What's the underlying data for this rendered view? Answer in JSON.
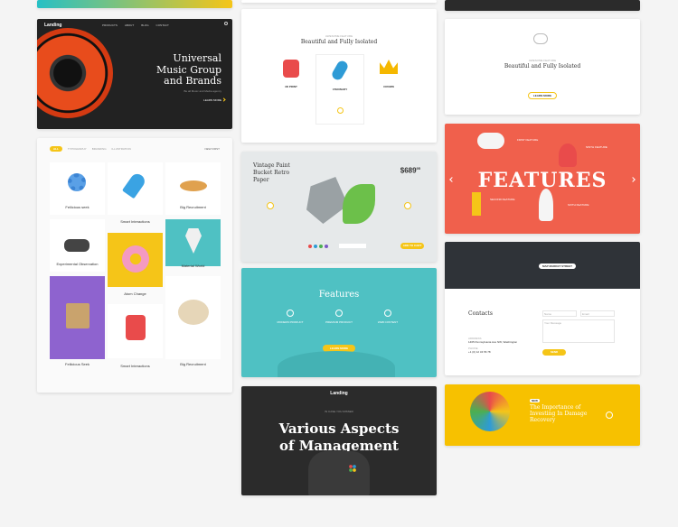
{
  "music": {
    "logo": "Landing",
    "nav": [
      "PRODUCTS",
      "ABOUT",
      "BLOG",
      "CONTACT"
    ],
    "title_lines": [
      "Universal",
      "Music Group",
      "and Brands"
    ],
    "subtitle": "Be all Music and Media agency",
    "cta": "LEARN MORE",
    "accent": "#f5c518"
  },
  "catalog": {
    "filters": [
      "ALL",
      "TYPOGRAPHY",
      "BRANDING",
      "ILLUSTRATION"
    ],
    "sort": "NEW FIRST",
    "items": [
      {
        "title": "Feliicious seek",
        "sub": "Illustration"
      },
      {
        "title": "Smart Interactions",
        "sub": "Illustration"
      },
      {
        "title": "Big Recruitment",
        "sub": "Illustration"
      },
      {
        "title": "Experimental Observation",
        "sub": "Illustration"
      },
      {
        "title": "Material World",
        "sub": "Illustration"
      },
      {
        "title": "Atom Change",
        "sub": "Illustration"
      },
      {
        "title": "Feliicious Seek",
        "sub": "Illustration"
      },
      {
        "title": "Smart Interactions",
        "sub": "Illustration"
      },
      {
        "title": "Big Recruitment",
        "sub": "Illustration"
      }
    ]
  },
  "features_white": {
    "label": "AWESOME FEATURE",
    "title": "Beautiful and Fully Isolated",
    "items": [
      {
        "name": "3D PRINT",
        "color": "#e94b4b"
      },
      {
        "name": "VISIONARY",
        "color": "#2e9bd6"
      },
      {
        "name": "CROWN",
        "color": "#f5b800"
      }
    ]
  },
  "product": {
    "title_lines": [
      "Vintage Paint",
      "Bucket Retro",
      "Paper"
    ],
    "price": "$689",
    "price_cents": "95",
    "cta": "ADD TO CART",
    "swatches": [
      "#e94b4b",
      "#2e9bd6",
      "#4caf50",
      "#7b59c4"
    ]
  },
  "features_teal": {
    "title": "Features",
    "items": [
      "MODERN PRODUCT",
      "PREMIUM PRODUCT",
      "WEB CONTENT"
    ],
    "cta": "LEARN MORE",
    "bg": "#4fc1c3"
  },
  "management": {
    "logo": "Landing",
    "kicker": "IN CASE YOU MISSED",
    "title_lines": [
      "Various Aspects",
      "of Management"
    ]
  },
  "features_right_white": {
    "label": "AWESOME FEATURE",
    "title": "Beautiful and Fully Isolated",
    "cta": "LEARN MORE"
  },
  "features_red": {
    "title": "FEATURES",
    "labels": [
      "FIRST FEATURE",
      "NINTH FEATURE",
      "SECOND FEATURE",
      "SIXTH FEATURE"
    ],
    "bg": "#f0604c"
  },
  "contacts": {
    "map_label": "MAP MARKET STREET",
    "title": "Contacts",
    "address_label": "ADDRESS",
    "address": "1465 Pennsylvania Ave NW, Washington",
    "phone_label": "PHONE",
    "phone": "+1 (0) 12 34 56 78",
    "fields": [
      "Name",
      "Email",
      "Your Message"
    ],
    "send": "SEND"
  },
  "damage": {
    "badge": "NEW",
    "title_lines": [
      "The Importance of",
      "Investing In Damage",
      "Recovery"
    ],
    "bg": "#f7c100"
  }
}
